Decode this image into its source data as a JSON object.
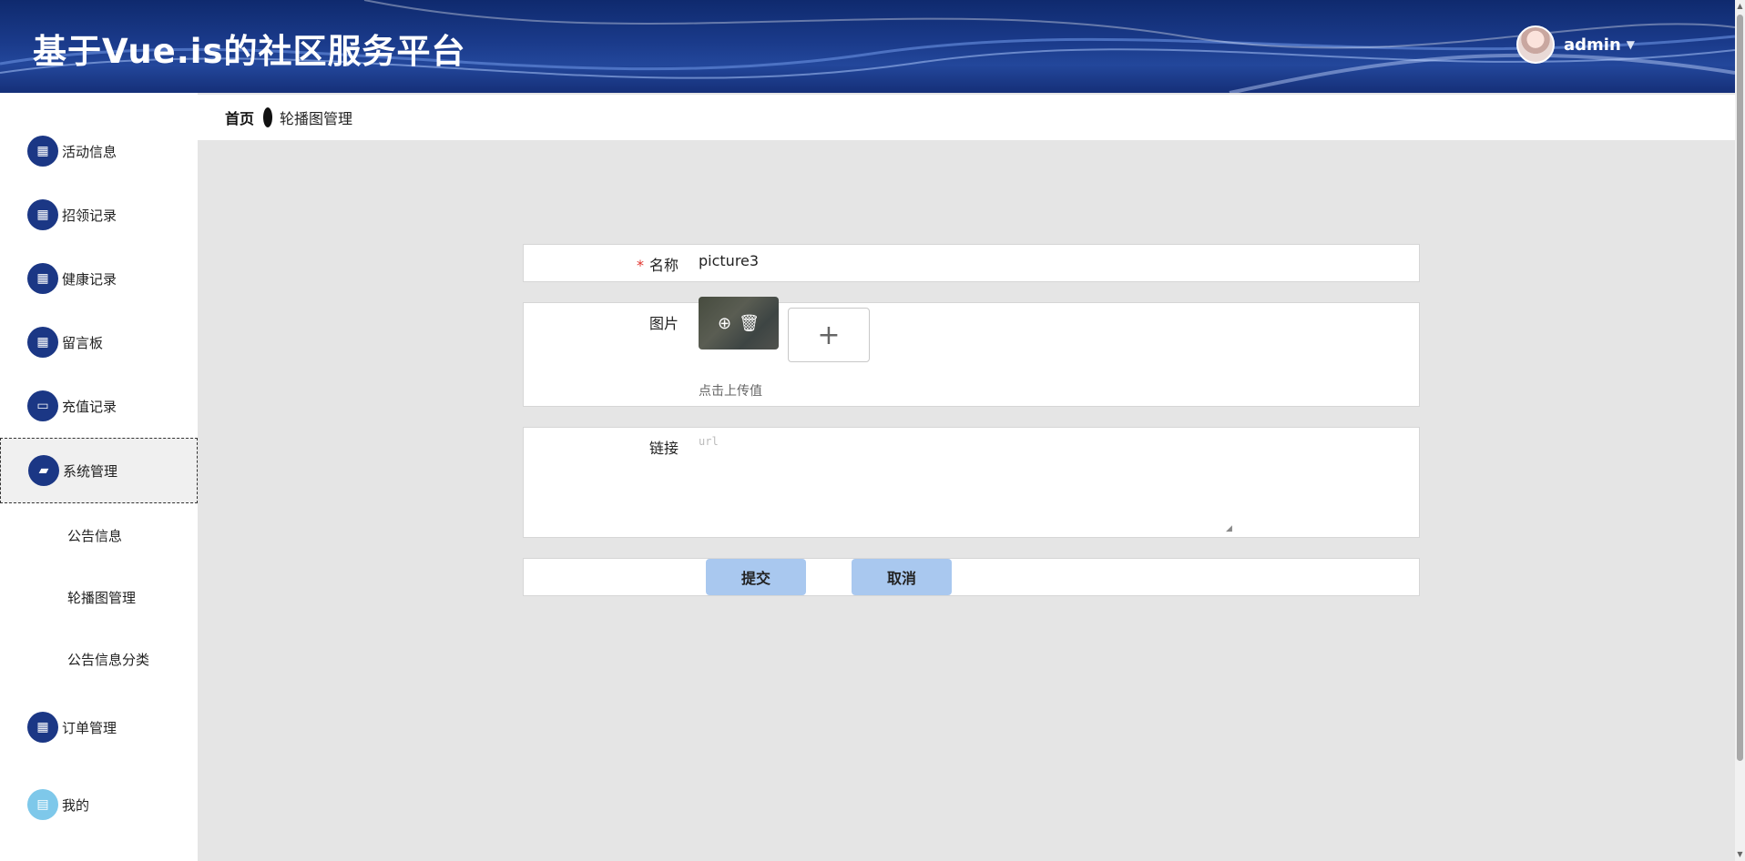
{
  "app": {
    "title": "基于Vue.is的社区服务平台"
  },
  "user": {
    "name": "admin",
    "caret": "▼",
    "avatar_icon": "avatar-photo"
  },
  "sidebar": {
    "items": [
      {
        "label": "活动信息",
        "icon": "grid-icon"
      },
      {
        "label": "招领记录",
        "icon": "grid-icon"
      },
      {
        "label": "健康记录",
        "icon": "grid-icon"
      },
      {
        "label": "留言板",
        "icon": "grid-icon"
      },
      {
        "label": "充值记录",
        "icon": "monitor-icon"
      },
      {
        "label": "系统管理",
        "icon": "ticket-icon",
        "active": true
      },
      {
        "label": "订单管理",
        "icon": "grid-icon"
      },
      {
        "label": "我的",
        "icon": "card-icon"
      }
    ],
    "sub_items": [
      "公告信息",
      "轮播图管理",
      "公告信息分类"
    ]
  },
  "breadcrumb": {
    "home": "首页",
    "current": "轮播图管理"
  },
  "form": {
    "name": {
      "label": "名称",
      "required_mark": "*",
      "value": "picture3"
    },
    "image": {
      "label": "图片",
      "add_symbol": "+",
      "hint": "点击上传值",
      "zoom_icon": "⊕",
      "delete_icon": "🗑"
    },
    "link": {
      "label": "链接",
      "placeholder": "url"
    },
    "submit_label": "提交",
    "cancel_label": "取消"
  },
  "colors": {
    "header_bg": "#1a3a8a",
    "icon_bg": "#1b3785",
    "button_bg": "#a9c8ef",
    "required": "#e0332c"
  }
}
